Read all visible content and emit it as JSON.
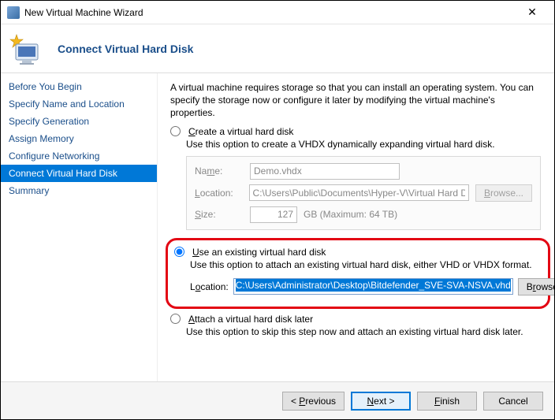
{
  "window": {
    "title": "New Virtual Machine Wizard",
    "close_glyph": "✕"
  },
  "header": {
    "title": "Connect Virtual Hard Disk"
  },
  "sidebar": {
    "steps": [
      "Before You Begin",
      "Specify Name and Location",
      "Specify Generation",
      "Assign Memory",
      "Configure Networking",
      "Connect Virtual Hard Disk",
      "Summary"
    ],
    "selected_index": 5
  },
  "content": {
    "intro": "A virtual machine requires storage so that you can install an operating system. You can specify the storage now or configure it later by modifying the virtual machine's properties.",
    "opt_create": {
      "label_pre": "C",
      "label_post": "reate a virtual hard disk",
      "desc": "Use this option to create a VHDX dynamically expanding virtual hard disk.",
      "name_label_pre": "Na",
      "name_label_post": "e:",
      "name_value": "Demo.vhdx",
      "loc_label_pre": "",
      "loc_label": "L",
      "loc_label_post": "ocation:",
      "loc_value": "C:\\Users\\Public\\Documents\\Hyper-V\\Virtual Hard Disks\\",
      "size_label_pre": "",
      "size_label": "S",
      "size_label_post": "ize:",
      "size_value": "127",
      "size_unit": "GB (Maximum: 64 TB)",
      "browse_pre": "",
      "browse": "B",
      "browse_post": "rowse..."
    },
    "opt_existing": {
      "label_pre": "",
      "label": "U",
      "label_post": "se an existing virtual hard disk",
      "desc": "Use this option to attach an existing virtual hard disk, either VHD or VHDX format.",
      "loc_label_pre": "L",
      "loc_label_post": "cation:",
      "loc_value": "C:\\Users\\Administrator\\Desktop\\Bitdefender_SVE-SVA-NSVA.vhd",
      "browse_pre": "B",
      "browse_post": "owse..."
    },
    "opt_later": {
      "label_pre": "",
      "label": "A",
      "label_post": "ttach a virtual hard disk later",
      "desc": "Use this option to skip this step now and attach an existing virtual hard disk later."
    }
  },
  "footer": {
    "previous_pre": "< ",
    "previous": "P",
    "previous_post": "revious",
    "next_pre": "",
    "next": "N",
    "next_post": "ext >",
    "finish_pre": "",
    "finish": "F",
    "finish_post": "inish",
    "cancel": "Cancel"
  }
}
